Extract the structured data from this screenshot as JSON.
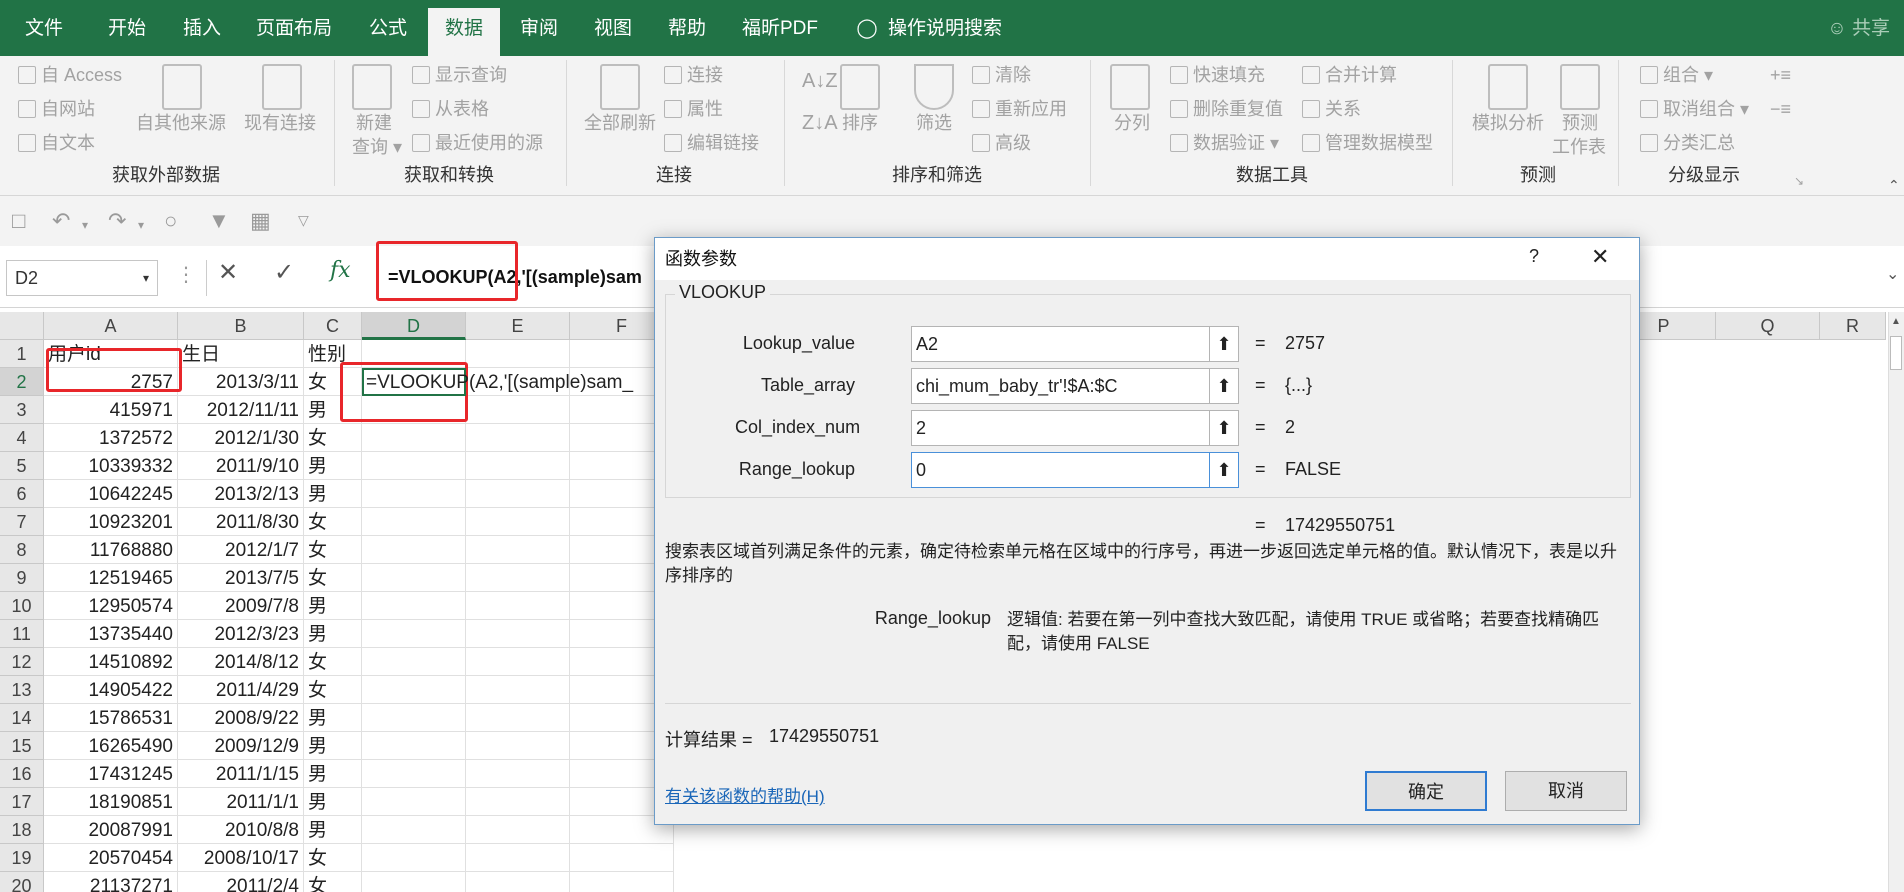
{
  "tabs": [
    "文件",
    "开始",
    "插入",
    "页面布局",
    "公式",
    "数据",
    "审阅",
    "视图",
    "帮助",
    "福昕PDF"
  ],
  "tell_me": "操作说明搜索",
  "share": "共享",
  "ribbon": {
    "get_external": {
      "access": "自 Access",
      "web": "自网站",
      "text": "自文本",
      "other": "自其他来源",
      "existing": "现有连接",
      "label": "获取外部数据"
    },
    "transform": {
      "new_query": "新建",
      "new_query2": "查询",
      "show_queries": "显示查询",
      "from_table": "从表格",
      "recent_sources": "最近使用的源",
      "label": "获取和转换"
    },
    "connections": {
      "refresh_all": "全部刷新",
      "connections": "连接",
      "properties": "属性",
      "edit_links": "编辑链接",
      "label": "连接"
    },
    "sort_filter": {
      "sort": "排序",
      "filter": "筛选",
      "clear": "清除",
      "reapply": "重新应用",
      "advanced": "高级",
      "label": "排序和筛选"
    },
    "data_tools": {
      "split": "分列",
      "flash_fill": "快速填充",
      "remove_dup": "删除重复值",
      "validation": "数据验证",
      "consolidate": "合并计算",
      "relations": "关系",
      "manage_model": "管理数据模型",
      "label": "数据工具"
    },
    "forecast": {
      "whatif": "模拟分析",
      "forecast_sheet": "预测",
      "forecast_sheet2": "工作表",
      "label": "预测"
    },
    "outline": {
      "group": "组合",
      "ungroup": "取消组合",
      "subtotal": "分类汇总",
      "label": "分级显示"
    }
  },
  "namebox": "D2",
  "formula": "=VLOOKUP(A2,'[(sample)sam",
  "columns": [
    "A",
    "B",
    "C",
    "D",
    "E",
    "F",
    "P",
    "Q",
    "R"
  ],
  "rows": [
    {
      "n": "1",
      "a": "用户id",
      "b": "生日",
      "c": "性别"
    },
    {
      "n": "2",
      "a": "2757",
      "b": "2013/3/11",
      "c": "女"
    },
    {
      "n": "3",
      "a": "415971",
      "b": "2012/11/11",
      "c": "男"
    },
    {
      "n": "4",
      "a": "1372572",
      "b": "2012/1/30",
      "c": "女"
    },
    {
      "n": "5",
      "a": "10339332",
      "b": "2011/9/10",
      "c": "男"
    },
    {
      "n": "6",
      "a": "10642245",
      "b": "2013/2/13",
      "c": "男"
    },
    {
      "n": "7",
      "a": "10923201",
      "b": "2011/8/30",
      "c": "女"
    },
    {
      "n": "8",
      "a": "11768880",
      "b": "2012/1/7",
      "c": "女"
    },
    {
      "n": "9",
      "a": "12519465",
      "b": "2013/7/5",
      "c": "女"
    },
    {
      "n": "10",
      "a": "12950574",
      "b": "2009/7/8",
      "c": "男"
    },
    {
      "n": "11",
      "a": "13735440",
      "b": "2012/3/23",
      "c": "男"
    },
    {
      "n": "12",
      "a": "14510892",
      "b": "2014/8/12",
      "c": "女"
    },
    {
      "n": "13",
      "a": "14905422",
      "b": "2011/4/29",
      "c": "女"
    },
    {
      "n": "14",
      "a": "15786531",
      "b": "2008/9/22",
      "c": "男"
    },
    {
      "n": "15",
      "a": "16265490",
      "b": "2009/12/9",
      "c": "男"
    },
    {
      "n": "16",
      "a": "17431245",
      "b": "2011/1/15",
      "c": "男"
    },
    {
      "n": "17",
      "a": "18190851",
      "b": "2011/1/1",
      "c": "男"
    },
    {
      "n": "18",
      "a": "20087991",
      "b": "2010/8/8",
      "c": "男"
    },
    {
      "n": "19",
      "a": "20570454",
      "b": "2008/10/17",
      "c": "女"
    },
    {
      "n": "20",
      "a": "21137271",
      "b": "2011/2/4",
      "c": "女"
    }
  ],
  "d2_formula": "=VLOOKUP(A2,'[(sample)sam_",
  "dialog": {
    "title": "函数参数",
    "help_q": "?",
    "close": "✕",
    "func": "VLOOKUP",
    "args": [
      {
        "label": "Lookup_value",
        "value": "A2",
        "result": "2757"
      },
      {
        "label": "Table_array",
        "value": "chi_mum_baby_tr'!$A:$C",
        "result": "{...}"
      },
      {
        "label": "Col_index_num",
        "value": "2",
        "result": "2"
      },
      {
        "label": "Range_lookup",
        "value": "0",
        "result": "FALSE"
      }
    ],
    "eq": "=",
    "total": "17429550751",
    "desc": "搜索表区域首列满足条件的元素，确定待检索单元格在区域中的行序号，再进一步返回选定单元格的值。默认情况下，表是以升序排序的",
    "param_name": "Range_lookup",
    "param_desc": "逻辑值: 若要在第一列中查找大致匹配，请使用 TRUE 或省略；若要查找精确匹配，请使用 FALSE",
    "calc_label": "计算结果 =",
    "calc_value": "17429550751",
    "help_link": "有关该函数的帮助(H)",
    "ok": "确定",
    "cancel": "取消"
  }
}
